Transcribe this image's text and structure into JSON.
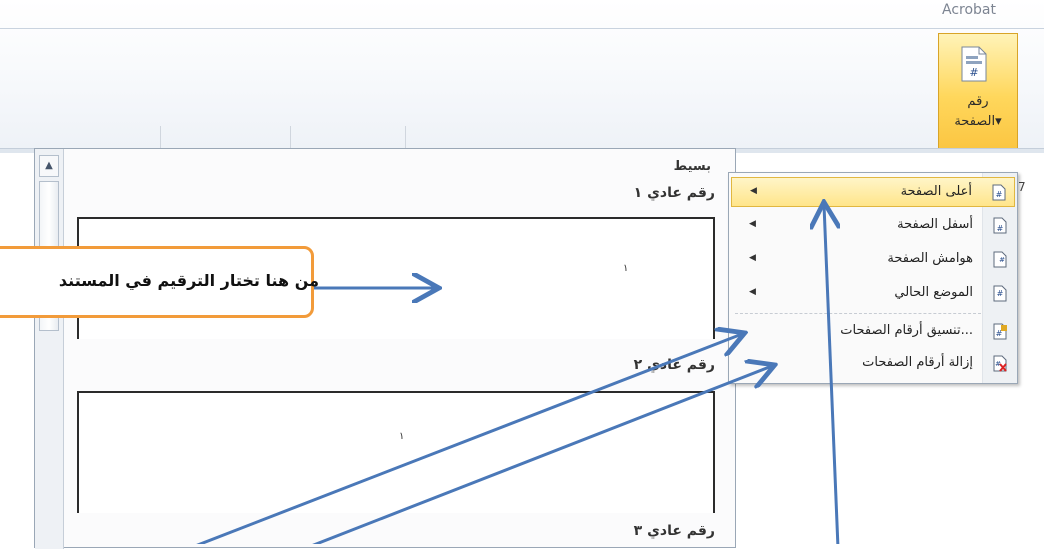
{
  "ribbon": {
    "tab_text": "Acrobat",
    "page_number_button": {
      "line1": "رقم",
      "line2": "الصفحة",
      "dropdown": "▾"
    },
    "edge_label": "7"
  },
  "gallery": {
    "header": "بسيط",
    "items": [
      {
        "label": "رقم عادي ١",
        "number": "١"
      },
      {
        "label": "رقم عادي ٢",
        "number": "١"
      },
      {
        "label": "رقم عادي ٣"
      }
    ]
  },
  "menu": {
    "items": [
      {
        "label": "أعلى الصفحة",
        "icon": "page-number-icon",
        "has_submenu": true,
        "selected": true
      },
      {
        "label": "أسفل الصفحة",
        "icon": "page-number-icon",
        "has_submenu": true
      },
      {
        "label": "هوامش الصفحة",
        "icon": "page-number-icon",
        "has_submenu": true
      },
      {
        "label": "الموضع الحالي",
        "icon": "page-number-icon",
        "has_submenu": true
      },
      {
        "label": "تنسيق أرقام الصفحات...",
        "icon": "format-page-numbers-icon"
      },
      {
        "label": "إزالة أرقام الصفحات",
        "icon": "remove-page-numbers-icon"
      }
    ]
  },
  "callout": {
    "text": "من هنا تختار الترقيم في المستند"
  },
  "colors": {
    "selection": "#ffe58a",
    "callout_border": "#f29b3a",
    "arrow": "#4a78b8"
  }
}
